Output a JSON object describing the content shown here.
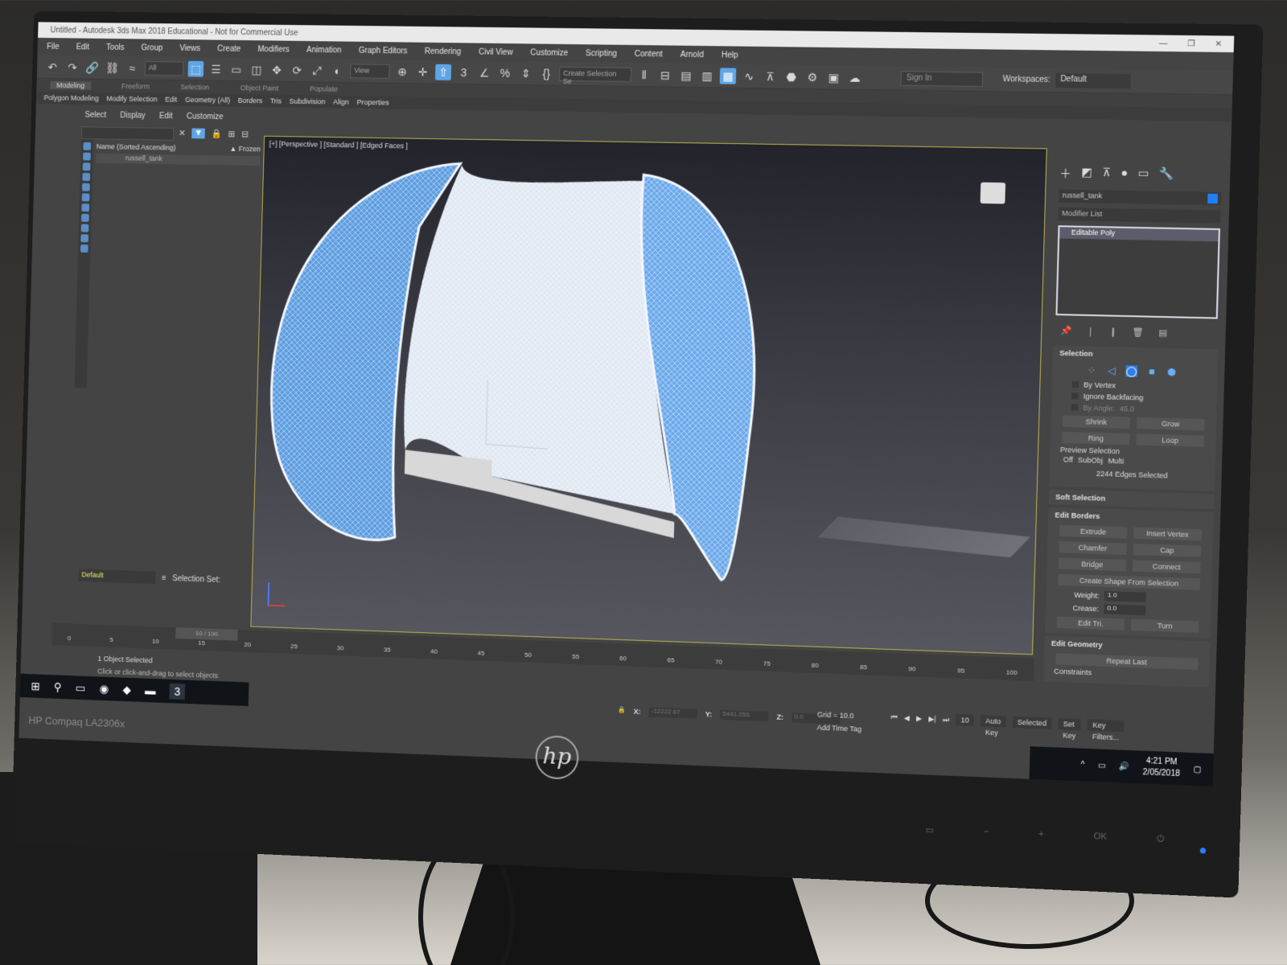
{
  "window": {
    "title": "Untitled - Autodesk 3ds Max 2018 Educational - Not for Commercial Use",
    "controls": [
      "—",
      "❐",
      "✕"
    ]
  },
  "menu": [
    "File",
    "Edit",
    "Tools",
    "Group",
    "Views",
    "Create",
    "Modifiers",
    "Animation",
    "Graph Editors",
    "Rendering",
    "Civil View",
    "Customize",
    "Scripting",
    "Content",
    "Arnold",
    "Help"
  ],
  "toolbar": {
    "filter_value": "All",
    "view_value": "View",
    "selection_set_placeholder": "Create Selection Se",
    "signin_label": "Sign In",
    "workspaces_label": "Workspaces:",
    "workspace_value": "Default"
  },
  "ribbon": {
    "tabs": [
      "Modeling",
      "Freeform",
      "Selection",
      "Object Paint",
      "Populate"
    ],
    "subtabs": [
      "Polygon Modeling",
      "Modify Selection",
      "Edit",
      "Geometry (All)",
      "Borders",
      "Tris",
      "Subdivision",
      "Align",
      "Properties"
    ]
  },
  "explorer": {
    "menu": [
      "Select",
      "Display",
      "Edit",
      "Customize"
    ],
    "column_name": "Name (Sorted Ascending)",
    "column_frozen": "▲ Frozen",
    "objects": [
      "russell_tank"
    ],
    "layer_value": "Default",
    "selection_set_label": "Selection Set:"
  },
  "viewport": {
    "label": "[+] [Perspective ] [Standard ] [Edged Faces ]"
  },
  "command_panel": {
    "object_name": "russell_tank",
    "object_color": "#1e7fff",
    "modifier_list_label": "Modifier List",
    "stack_item": "Editable Poly",
    "selection": {
      "title": "Selection",
      "by_vertex": "By Vertex",
      "ignore_backfacing": "Ignore Backfacing",
      "by_angle_label": "By Angle:",
      "by_angle_value": "45.0",
      "shrink": "Shrink",
      "grow": "Grow",
      "ring": "Ring",
      "loop": "Loop",
      "preview_label": "Preview Selection",
      "preview_options": [
        "Off",
        "SubObj",
        "Multi"
      ],
      "status": "2244 Edges Selected"
    },
    "soft_selection_title": "Soft Selection",
    "edit_borders": {
      "title": "Edit Borders",
      "extrude": "Extrude",
      "insert_vertex": "Insert Vertex",
      "chamfer": "Chamfer",
      "cap": "Cap",
      "bridge": "Bridge",
      "connect": "Connect",
      "create_shape": "Create Shape From Selection",
      "weight_label": "Weight:",
      "weight_value": "1.0",
      "crease_label": "Crease:",
      "crease_value": "0.0",
      "edit_tri": "Edit Tri.",
      "turn": "Turn"
    },
    "edit_geometry": {
      "title": "Edit Geometry",
      "repeat_last": "Repeat Last",
      "constraints": "Constraints"
    }
  },
  "timeline": {
    "frame_display": "10 / 100",
    "ticks": [
      "0",
      "5",
      "10",
      "15",
      "20",
      "25",
      "30",
      "35",
      "40",
      "45",
      "50",
      "55",
      "60",
      "65",
      "70",
      "75",
      "80",
      "85",
      "90",
      "95",
      "100"
    ]
  },
  "status": {
    "line1": "1 Object Selected",
    "line2": "Click or click-and-drag to select objects",
    "x_label": "X:",
    "x_value": "-12222.67",
    "y_label": "Y:",
    "y_value": "5441.055",
    "z_label": "Z:",
    "z_value": "0.0",
    "grid": "Grid = 10.0",
    "add_time_tag": "Add Time Tag",
    "auto_key": "Auto Key",
    "selected": "Selected",
    "set_key": "Set Key",
    "key_filters": "Key Filters...",
    "current_frame": "10"
  },
  "taskbar": {
    "time": "4:21 PM",
    "date": "2/05/2018"
  },
  "monitor": {
    "brand": "HP Compaq LA2306x",
    "logo": "hp"
  }
}
